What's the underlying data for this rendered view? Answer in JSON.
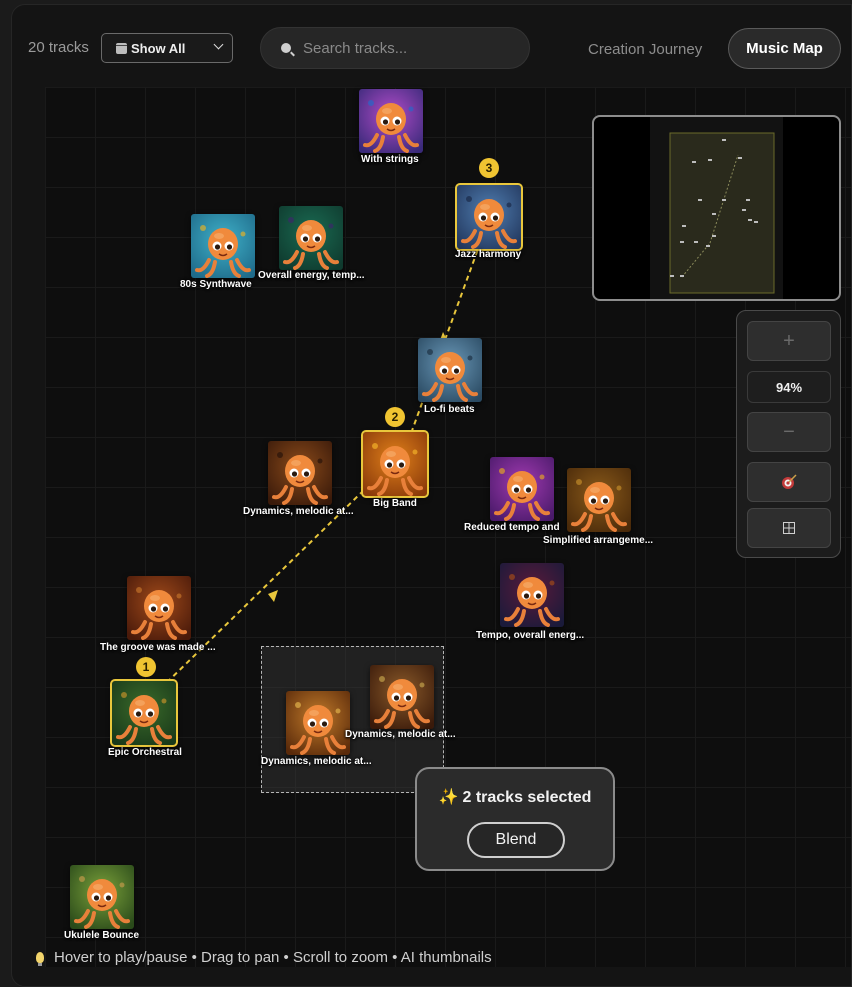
{
  "header": {
    "track_count": "20 tracks",
    "filter_label": "Show All",
    "search_placeholder": "Search tracks...",
    "tab_journey": "Creation Journey",
    "tab_map": "Music Map"
  },
  "tracks": [
    {
      "label": "With strings",
      "palette": [
        "#3a2a7a",
        "#b04cc8",
        "#2a66c8"
      ]
    },
    {
      "label": "Jazz harmony",
      "palette": [
        "#23385e",
        "#4f7db0",
        "#1a2a48"
      ],
      "badge": "3"
    },
    {
      "label": "80s Synthwave",
      "palette": [
        "#1f6b8a",
        "#3fb0c8",
        "#e0b02a"
      ]
    },
    {
      "label": "Overall energy, temp...",
      "palette": [
        "#0f3a2e",
        "#1a6a52",
        "#3a2a6a"
      ]
    },
    {
      "label": "Lo-fi beats",
      "palette": [
        "#2a4a62",
        "#6a98b8",
        "#1e3244"
      ]
    },
    {
      "label": "Big Band",
      "palette": [
        "#8a3a0a",
        "#e0801a",
        "#f2b02a"
      ],
      "badge": "2"
    },
    {
      "label": "Dynamics, melodic at...",
      "palette": [
        "#3a1a0a",
        "#8a4a1a",
        "#2a140a"
      ]
    },
    {
      "label": "Reduced tempo and",
      "palette": [
        "#4a1a6a",
        "#a03ab0",
        "#e0a02a"
      ]
    },
    {
      "label": "Simplified arrangeme...",
      "palette": [
        "#4a2a0a",
        "#8a5a1a",
        "#c08a2a"
      ]
    },
    {
      "label": "Tempo, overall energ...",
      "palette": [
        "#1a1a3a",
        "#5a1a3a",
        "#a04a1a"
      ]
    },
    {
      "label": "The groove was made ...",
      "palette": [
        "#4a1a0a",
        "#a04a1a",
        "#c0702a"
      ]
    },
    {
      "label": "Epic Orchestral",
      "palette": [
        "#1a3a1a",
        "#3a6a2a",
        "#c0902a"
      ],
      "badge": "1"
    },
    {
      "label": "Dynamics, melodic at...",
      "palette": [
        "#5a2a0a",
        "#c07a2a",
        "#e0b04a"
      ]
    },
    {
      "label": "Dynamics, melodic at...",
      "palette": [
        "#3a1a0a",
        "#8a5a2a",
        "#c0a04a"
      ]
    },
    {
      "label": "Ukulele Bounce",
      "palette": [
        "#2a4a1a",
        "#7aa03a",
        "#c09a4a"
      ]
    }
  ],
  "selection": {
    "count_text": "2 tracks selected",
    "blend_label": "Blend"
  },
  "controls": {
    "zoom_in": "+",
    "zoom_level": "94%",
    "zoom_out": "−",
    "locate_icon": "target-icon",
    "fit_icon": "grid-fit-icon"
  },
  "footer": {
    "hint": "Hover to play/pause • Drag to pan • Scroll to zoom • AI thumbnails"
  },
  "colors": {
    "accent": "#f0c431",
    "path": "#e9c73c"
  }
}
